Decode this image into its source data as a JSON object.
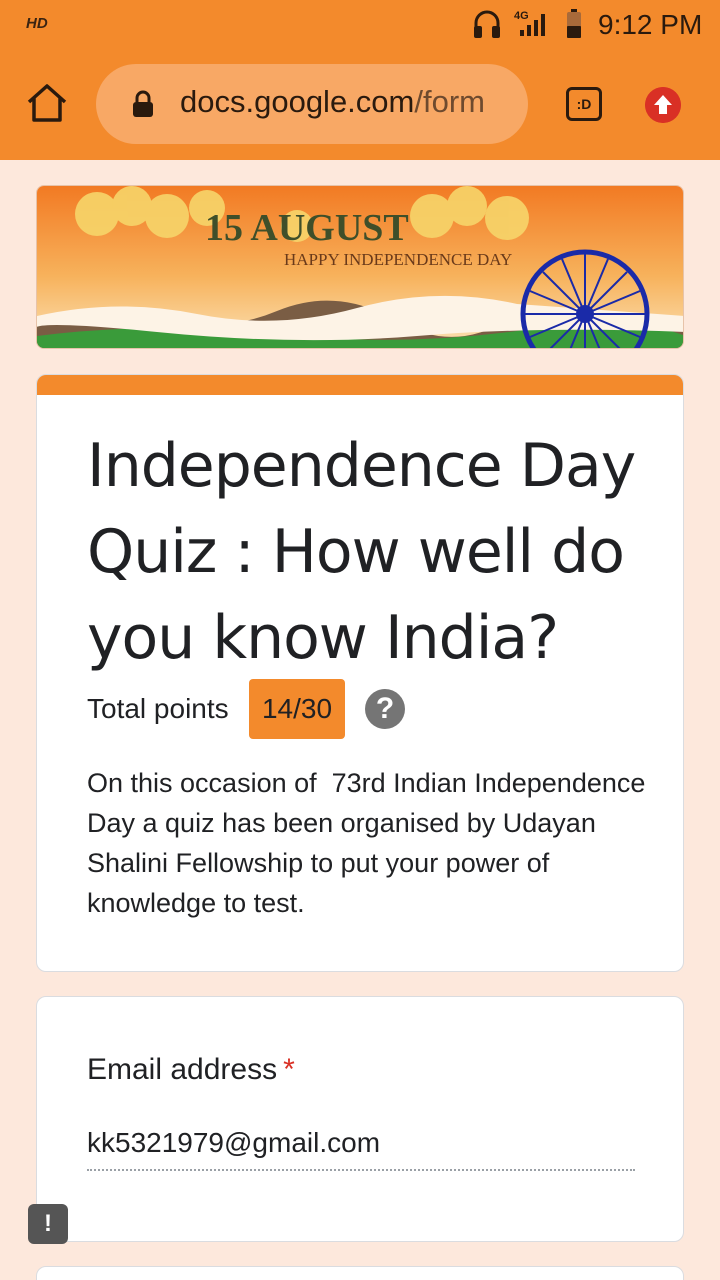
{
  "status_bar": {
    "hd_label": "HD",
    "network_label": "4G",
    "time": "9:12 PM",
    "icons": [
      "headphones-icon",
      "signal-icon",
      "battery-icon"
    ]
  },
  "browser": {
    "url_main": "docs.google.com",
    "url_faded": "/form",
    "tab_switcher_label": ":D",
    "icons": [
      "home-icon",
      "lock-icon",
      "update-icon"
    ]
  },
  "banner": {
    "heading": "15 AUGUST",
    "subheading": "HAPPY INDEPENDENCE DAY"
  },
  "form": {
    "title": "Independence Day Quiz : How well do you know India?",
    "points_label": "Total points",
    "points_value": "14/30",
    "help_symbol": "?",
    "description": "On this occasion of  73rd Indian Independence Day a quiz has been organised by Udayan Shalini Fellowship to put your power of knowledge to test."
  },
  "email_question": {
    "label": "Email address",
    "required_marker": "*",
    "value": "kk5321979@gmail.com"
  },
  "feedback": {
    "symbol": "!"
  },
  "colors": {
    "accent": "#f38a2c",
    "page_background": "#fde8dc",
    "required": "#d93025"
  }
}
